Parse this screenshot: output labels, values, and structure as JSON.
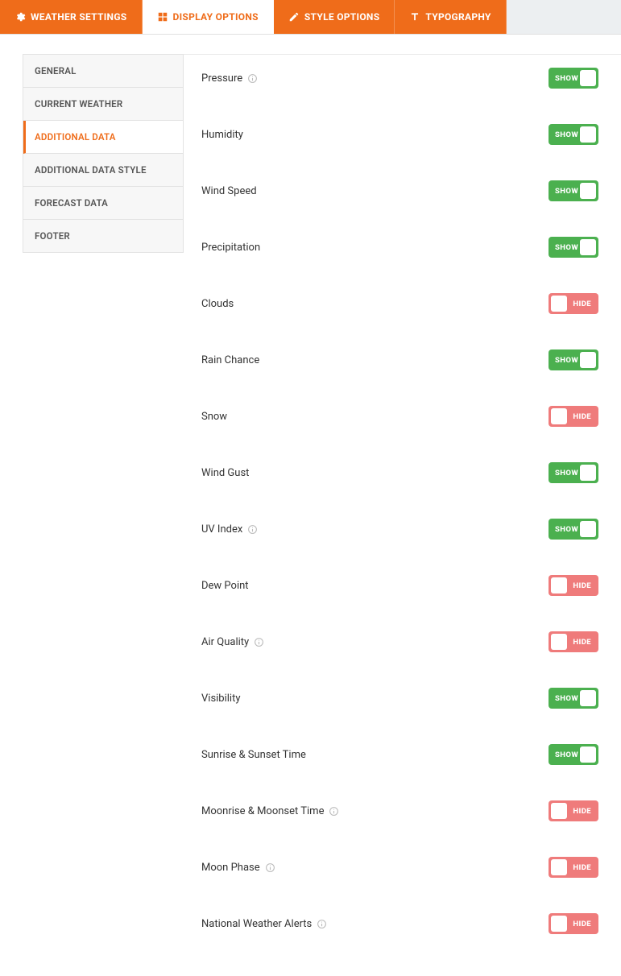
{
  "tabs": [
    {
      "label": "WEATHER SETTINGS",
      "active": false,
      "icon": "settings"
    },
    {
      "label": "DISPLAY OPTIONS",
      "active": true,
      "icon": "grid"
    },
    {
      "label": "STYLE OPTIONS",
      "active": false,
      "icon": "pencil"
    },
    {
      "label": "TYPOGRAPHY",
      "active": false,
      "icon": "type"
    }
  ],
  "sidebar": [
    {
      "label": "GENERAL",
      "active": false
    },
    {
      "label": "CURRENT WEATHER",
      "active": false
    },
    {
      "label": "ADDITIONAL DATA",
      "active": true
    },
    {
      "label": "ADDITIONAL DATA STYLE",
      "active": false
    },
    {
      "label": "FORECAST DATA",
      "active": false
    },
    {
      "label": "FOOTER",
      "active": false
    }
  ],
  "toggle_labels": {
    "show": "SHOW",
    "hide": "HIDE"
  },
  "options": [
    {
      "label": "Pressure",
      "info": true,
      "state": "show"
    },
    {
      "label": "Humidity",
      "info": false,
      "state": "show"
    },
    {
      "label": "Wind Speed",
      "info": false,
      "state": "show"
    },
    {
      "label": "Precipitation",
      "info": false,
      "state": "show"
    },
    {
      "label": "Clouds",
      "info": false,
      "state": "hide"
    },
    {
      "label": "Rain Chance",
      "info": false,
      "state": "show"
    },
    {
      "label": "Snow",
      "info": false,
      "state": "hide"
    },
    {
      "label": "Wind Gust",
      "info": false,
      "state": "show"
    },
    {
      "label": "UV Index",
      "info": true,
      "state": "show"
    },
    {
      "label": "Dew Point",
      "info": false,
      "state": "hide"
    },
    {
      "label": "Air Quality",
      "info": true,
      "state": "hide"
    },
    {
      "label": "Visibility",
      "info": false,
      "state": "show"
    },
    {
      "label": "Sunrise & Sunset Time",
      "info": false,
      "state": "show"
    },
    {
      "label": "Moonrise & Moonset Time",
      "info": true,
      "state": "hide"
    },
    {
      "label": "Moon Phase",
      "info": true,
      "state": "hide"
    },
    {
      "label": "National Weather Alerts",
      "info": true,
      "state": "hide"
    }
  ]
}
